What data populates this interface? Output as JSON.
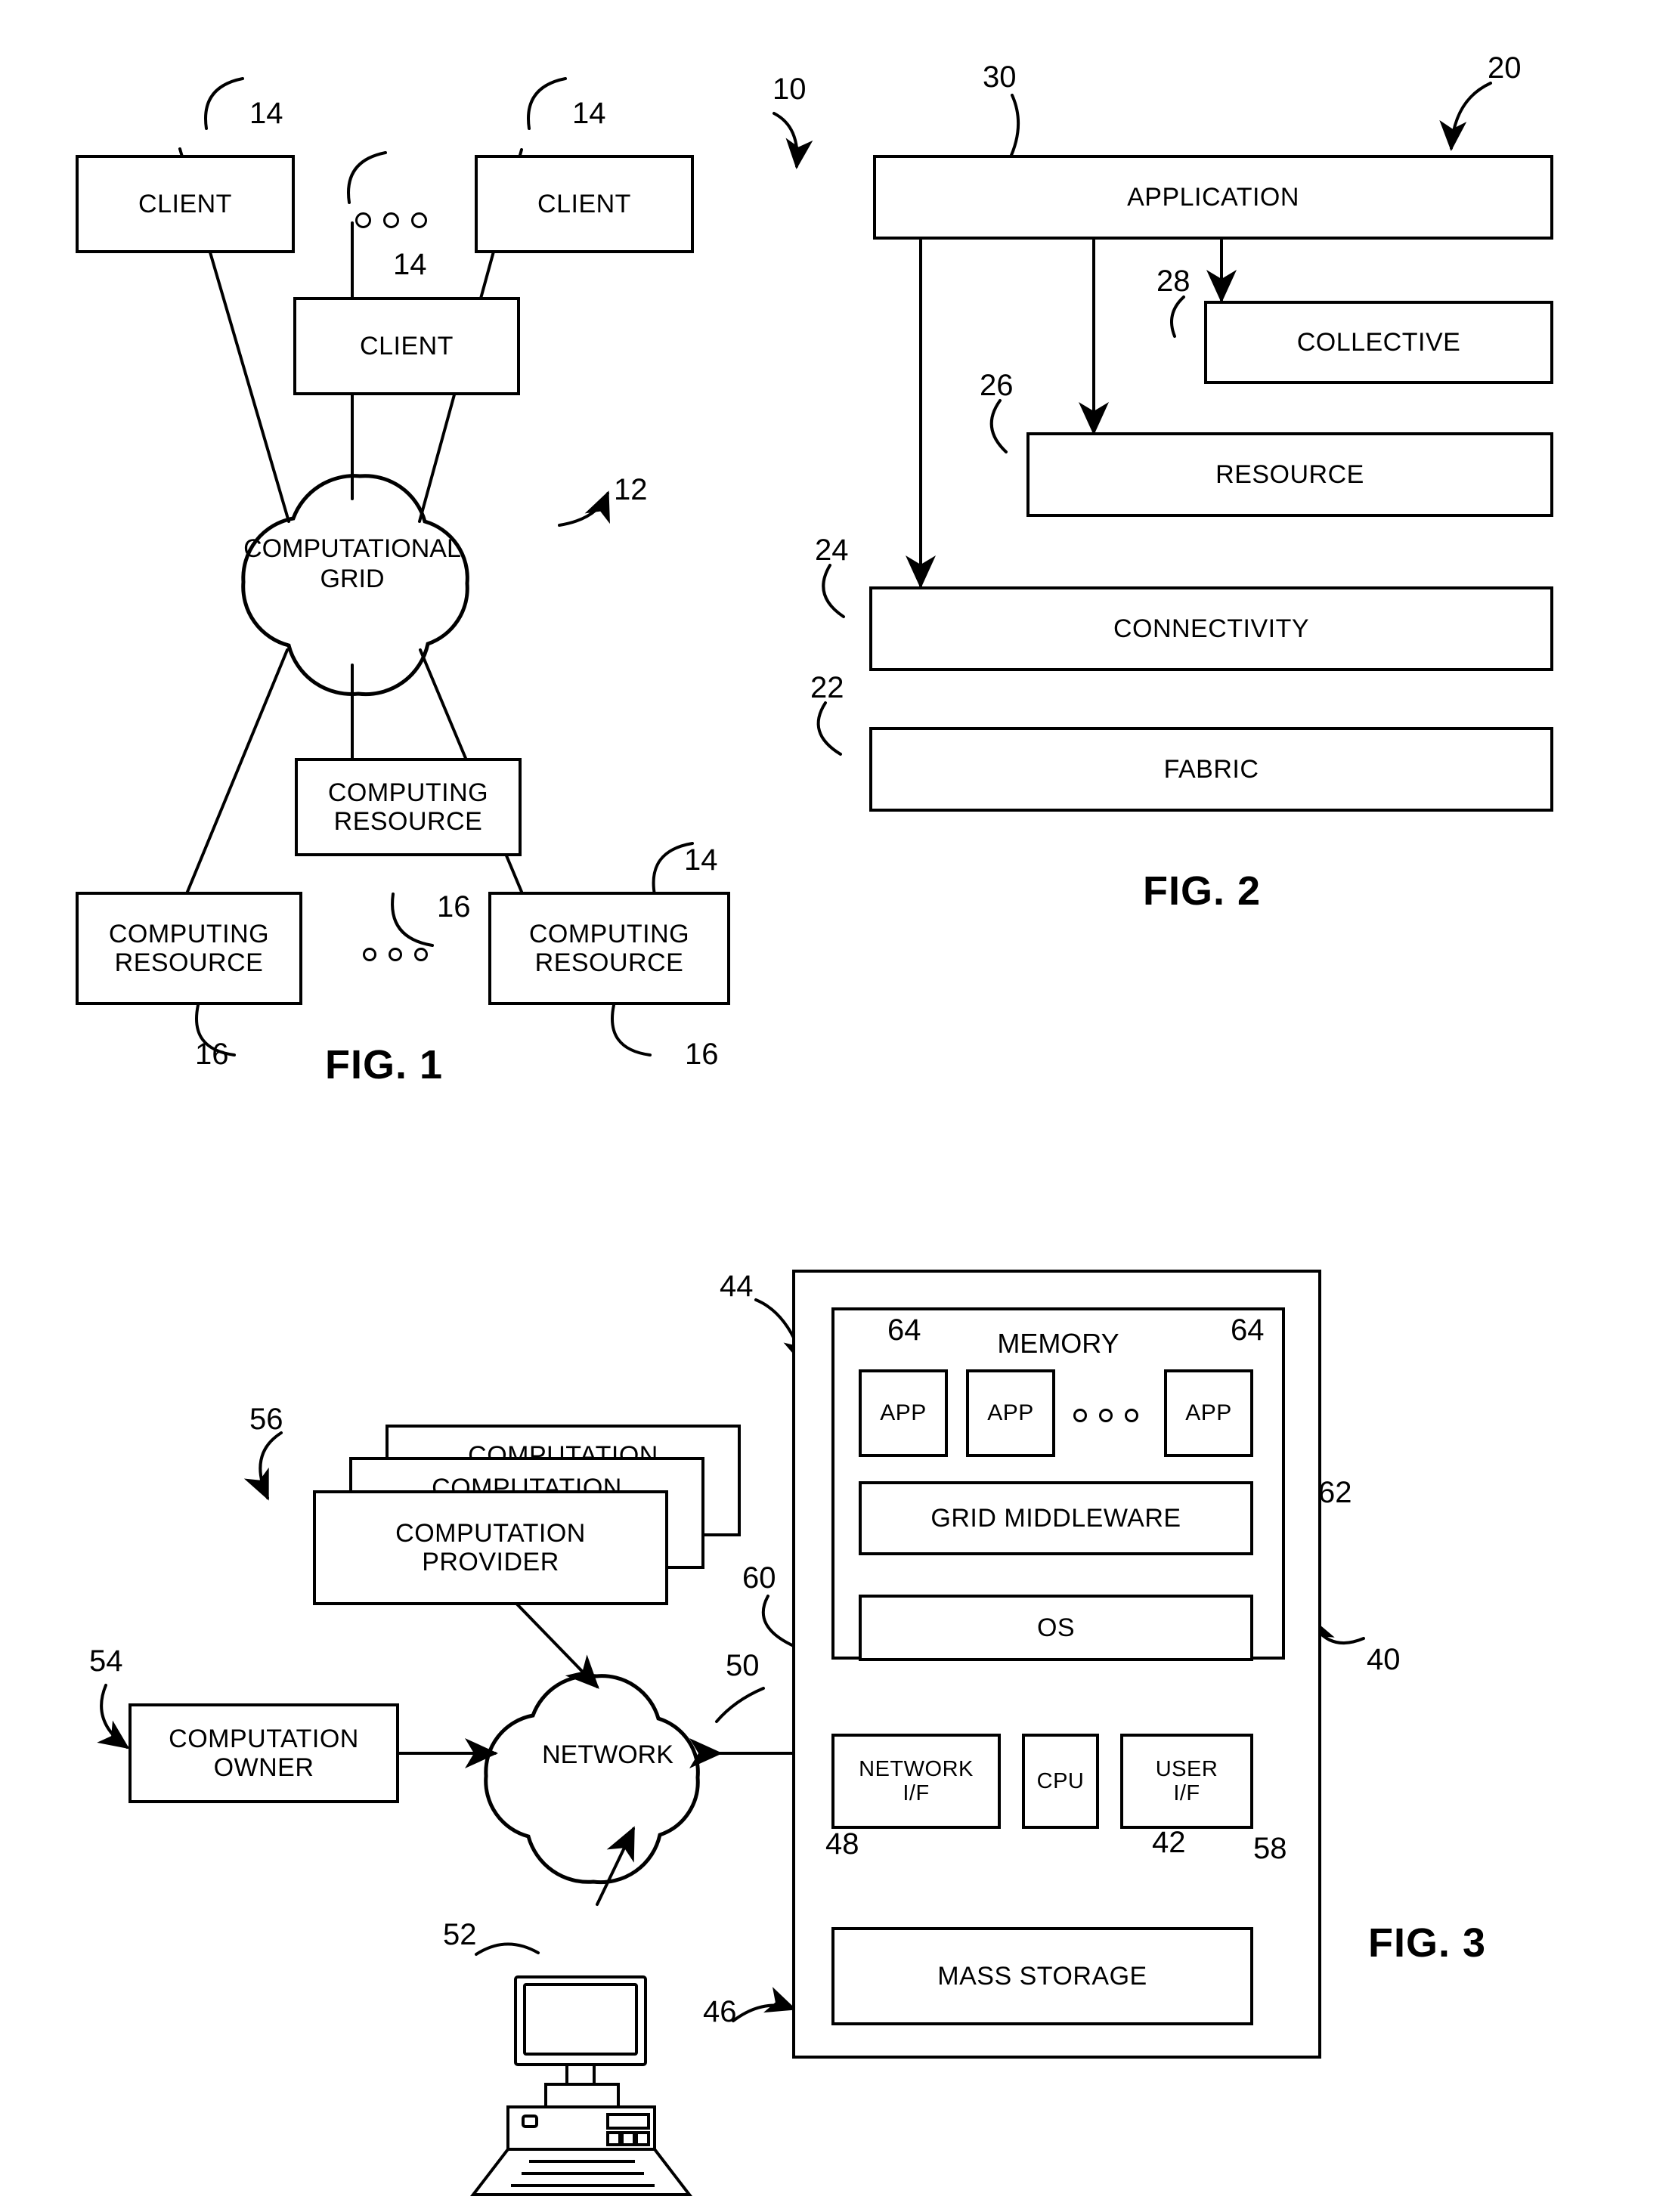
{
  "document": {
    "kind": "patent-drawing-sheet",
    "figures": [
      "FIG. 1",
      "FIG. 2",
      "FIG. 3"
    ]
  },
  "fig1": {
    "label": "FIG. 1",
    "blocks": {
      "client_left": "CLIENT",
      "client_right": "CLIENT",
      "client_mid": "CLIENT",
      "cloud_line1": "COMPUTATIONAL",
      "cloud_line2": "GRID",
      "res_mid_line1": "COMPUTING",
      "res_mid_line2": "RESOURCE",
      "res_left_line1": "COMPUTING",
      "res_left_line2": "RESOURCE",
      "res_right_line1": "COMPUTING",
      "res_right_line2": "RESOURCE"
    },
    "refs": {
      "system": "10",
      "grid": "12",
      "client_left": "14",
      "client_right": "14",
      "client_mid": "14",
      "client_right_lower": "14",
      "res_mid": "16",
      "res_left": "16",
      "res_right": "16"
    }
  },
  "fig2": {
    "label": "FIG. 2",
    "blocks": {
      "application": "APPLICATION",
      "collective": "COLLECTIVE",
      "resource": "RESOURCE",
      "connectivity": "CONNECTIVITY",
      "fabric": "FABRIC"
    },
    "refs": {
      "stack": "20",
      "application": "30",
      "collective": "28",
      "resource": "26",
      "connectivity": "24",
      "fabric": "22"
    }
  },
  "fig3": {
    "label": "FIG. 3",
    "blocks": {
      "memory_title": "MEMORY",
      "app1": "APP",
      "app2": "APP",
      "app3": "APP",
      "grid_middleware": "GRID MIDDLEWARE",
      "os": "OS",
      "network_if_line1": "NETWORK",
      "network_if_line2": "I/F",
      "cpu": "CPU",
      "user_if_line1": "USER",
      "user_if_line2": "I/F",
      "mass_storage": "MASS STORAGE",
      "computation_provider_line1": "COMPUTATION",
      "computation_provider_line2": "PROVIDER",
      "computation_provider_stack2": "COMPUTATION",
      "computation_provider_stack3": "COMPUTATION",
      "computation_owner_line1": "COMPUTATION",
      "computation_owner_line2": "OWNER",
      "network_cloud": "NETWORK"
    },
    "refs": {
      "memory": "44",
      "app_left": "64",
      "app_right": "64",
      "grid_middleware": "62",
      "os": "60",
      "computer": "40",
      "network_if": "48",
      "cpu": "42",
      "user_if": "58",
      "mass_storage": "46",
      "network": "50",
      "terminal": "52",
      "computation_owner": "54",
      "computation_provider": "56"
    }
  }
}
